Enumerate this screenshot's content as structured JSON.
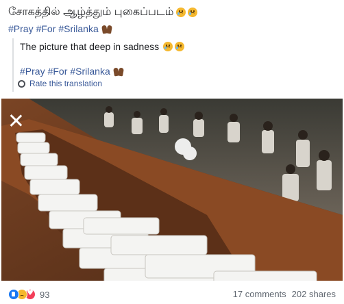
{
  "post": {
    "title": "சோகத்தில் ஆழ்த்தும் புகைப்படம்",
    "title_emojis": [
      "sad-face-icon",
      "sad-face-icon"
    ],
    "hashtags": [
      "#Pray",
      "#For",
      "#Srilanka"
    ],
    "hashtag_emoji": "praying-hands-icon"
  },
  "translation": {
    "text": "The picture that deep in sadness",
    "hashtags": [
      "#Pray",
      "#For",
      "#Srilanka"
    ],
    "rate_label": "Rate this translation"
  },
  "photo": {
    "description_icon": "close-icon"
  },
  "footer": {
    "reaction_icons": [
      "like-icon",
      "sad-icon",
      "love-icon"
    ],
    "reaction_count": "93",
    "comments": "17 comments",
    "shares": "202 shares"
  },
  "colors": {
    "link": "#385898",
    "text": "#1c1e21",
    "muted": "#606770",
    "border": "#dddfe2",
    "like": "#1877f2",
    "love": "#f33e58",
    "sad": "#f5b82e"
  }
}
